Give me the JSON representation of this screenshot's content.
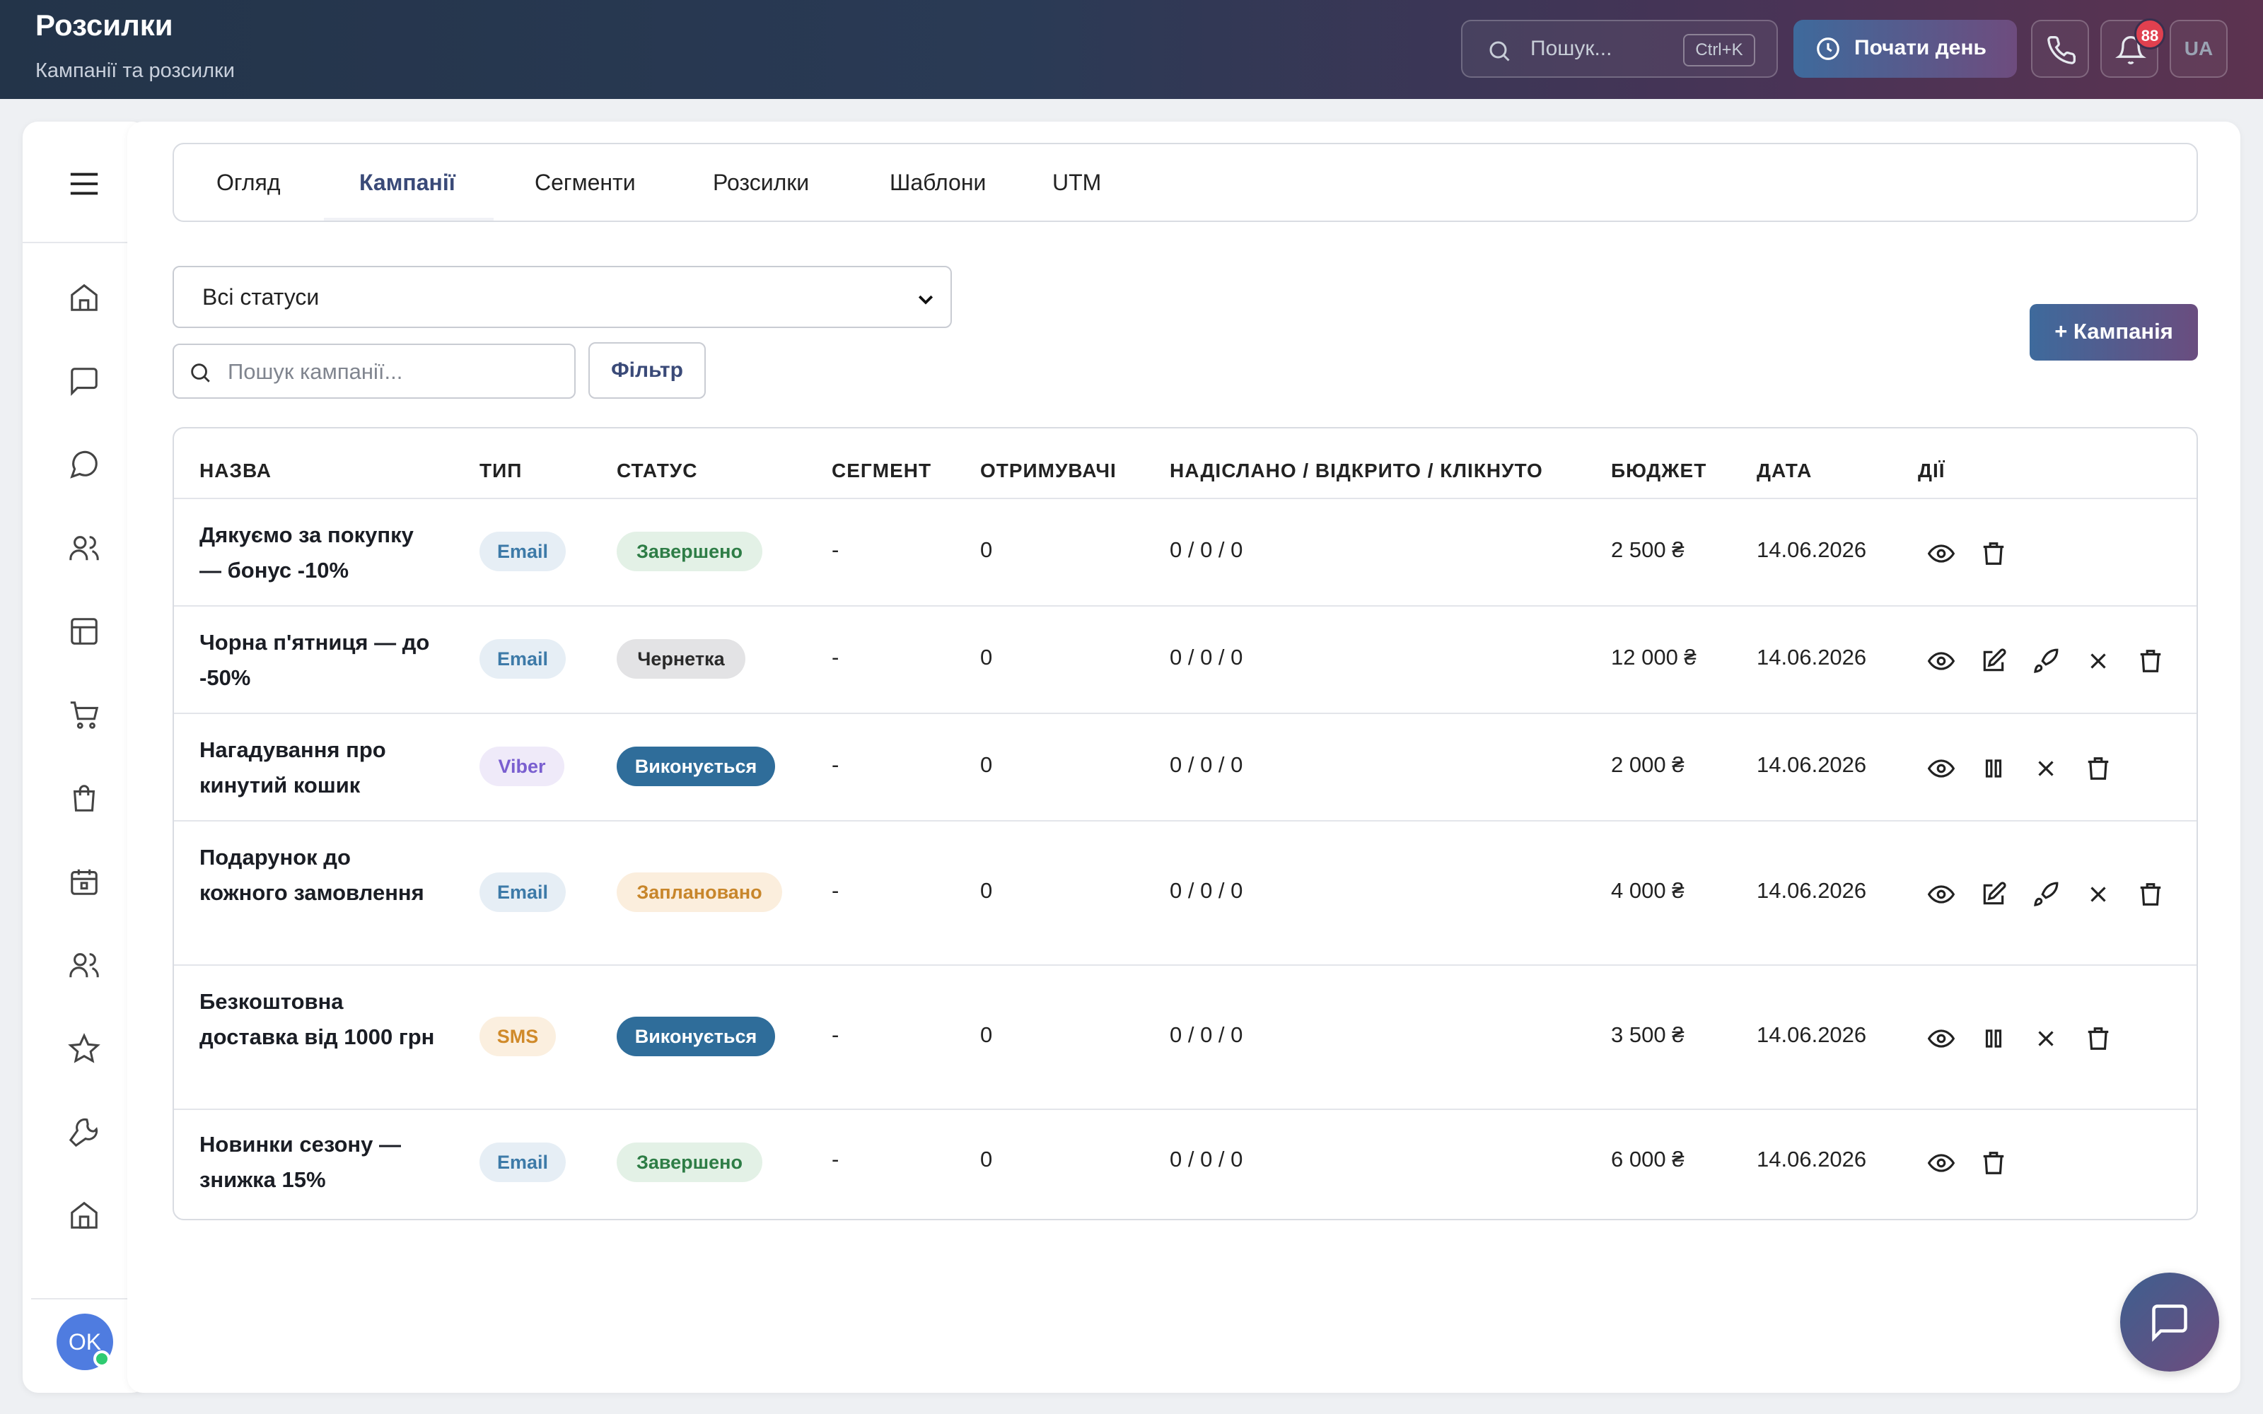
{
  "header": {
    "title": "Розсилки",
    "subtitle": "Кампанії та розсилки",
    "search_placeholder": "Пошук...",
    "search_shortcut": "Ctrl+K",
    "start_day_label": "Почати день",
    "notifications_count": "88",
    "language": "UA"
  },
  "sidebar": {
    "avatar_initials": "OK",
    "icons": [
      "home-icon",
      "message-square-icon",
      "message-circle-icon",
      "users-icon",
      "layout-icon",
      "cart-icon",
      "shopping-bag-icon",
      "calendar-icon",
      "team-icon",
      "star-icon",
      "wrench-icon",
      "building-icon"
    ]
  },
  "tabs": [
    {
      "label": "Огляд",
      "active": false
    },
    {
      "label": "Кампанії",
      "active": true
    },
    {
      "label": "Сегменти",
      "active": false
    },
    {
      "label": "Розсилки",
      "active": false
    },
    {
      "label": "Шаблони",
      "active": false
    },
    {
      "label": "UTM",
      "active": false
    }
  ],
  "filters": {
    "status_select": "Всі статуси",
    "search_placeholder": "Пошук кампанії...",
    "filter_button": "Фільтр",
    "add_button": "+ Кампанія"
  },
  "table": {
    "columns": [
      "НАЗВА",
      "ТИП",
      "СТАТУС",
      "СЕГМЕНТ",
      "ОТРИМУВАЧІ",
      "НАДІСЛАНО / ВІДКРИТО / КЛІКНУТО",
      "БЮДЖЕТ",
      "ДАТА",
      "ДІЇ"
    ],
    "rows": [
      {
        "name": "Дякуємо за покупку — бонус -10%",
        "type": "Email",
        "status": "Завершено",
        "segment": "-",
        "recipients": "0",
        "stats": "0 / 0 / 0",
        "budget": "2 500 ₴",
        "date": "14.06.2026",
        "actions": [
          "eye-icon",
          "trash-icon"
        ]
      },
      {
        "name": "Чорна п'ятниця — до -50%",
        "type": "Email",
        "status": "Чернетка",
        "segment": "-",
        "recipients": "0",
        "stats": "0 / 0 / 0",
        "budget": "12 000 ₴",
        "date": "14.06.2026",
        "actions": [
          "eye-icon",
          "edit-icon",
          "rocket-icon",
          "close-icon",
          "trash-icon"
        ]
      },
      {
        "name": "Нагадування про кинутий кошик",
        "type": "Viber",
        "status": "Виконується",
        "segment": "-",
        "recipients": "0",
        "stats": "0 / 0 / 0",
        "budget": "2 000 ₴",
        "date": "14.06.2026",
        "actions": [
          "eye-icon",
          "pause-icon",
          "close-icon",
          "trash-icon"
        ]
      },
      {
        "name": "Подарунок до кожного замовлення",
        "type": "Email",
        "status": "Заплановано",
        "segment": "-",
        "recipients": "0",
        "stats": "0 / 0 / 0",
        "budget": "4 000 ₴",
        "date": "14.06.2026",
        "actions": [
          "eye-icon",
          "edit-icon",
          "rocket-icon",
          "close-icon",
          "trash-icon"
        ]
      },
      {
        "name": "Безкоштовна доставка від 1000 грн",
        "type": "SMS",
        "status": "Виконується",
        "segment": "-",
        "recipients": "0",
        "stats": "0 / 0 / 0",
        "budget": "3 500 ₴",
        "date": "14.06.2026",
        "actions": [
          "eye-icon",
          "pause-icon",
          "close-icon",
          "trash-icon"
        ]
      },
      {
        "name": "Новинки сезону — знижка 15%",
        "type": "Email",
        "status": "Завершено",
        "segment": "-",
        "recipients": "0",
        "stats": "0 / 0 / 0",
        "budget": "6 000 ₴",
        "date": "14.06.2026",
        "actions": [
          "eye-icon",
          "trash-icon"
        ]
      }
    ]
  },
  "colors": {
    "accent": "#3a4a78",
    "status_running": "#2f6d9a",
    "status_done": "#2e7d46",
    "status_planned": "#c8862b"
  }
}
